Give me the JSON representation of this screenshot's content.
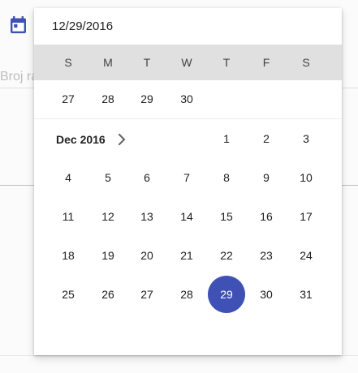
{
  "input": {
    "value": "12/29/2016"
  },
  "background": {
    "hint_text": "Broj ra"
  },
  "weekdays": [
    "S",
    "M",
    "T",
    "W",
    "T",
    "F",
    "S"
  ],
  "prev_month": {
    "days": [
      "27",
      "28",
      "29",
      "30"
    ]
  },
  "current_month": {
    "label": "Dec 2016",
    "selected_day": "29",
    "weeks": [
      [
        "",
        "",
        "",
        "",
        "1",
        "2",
        "3"
      ],
      [
        "4",
        "5",
        "6",
        "7",
        "8",
        "9",
        "10"
      ],
      [
        "11",
        "12",
        "13",
        "14",
        "15",
        "16",
        "17"
      ],
      [
        "18",
        "19",
        "20",
        "21",
        "22",
        "23",
        "24"
      ],
      [
        "25",
        "26",
        "27",
        "28",
        "29",
        "30",
        "31"
      ]
    ]
  },
  "icons": {
    "calendar": "calendar-icon",
    "next": "chevron-right-icon"
  },
  "colors": {
    "accent": "#3f51b5",
    "weekday_bar": "#e0e0e0"
  }
}
